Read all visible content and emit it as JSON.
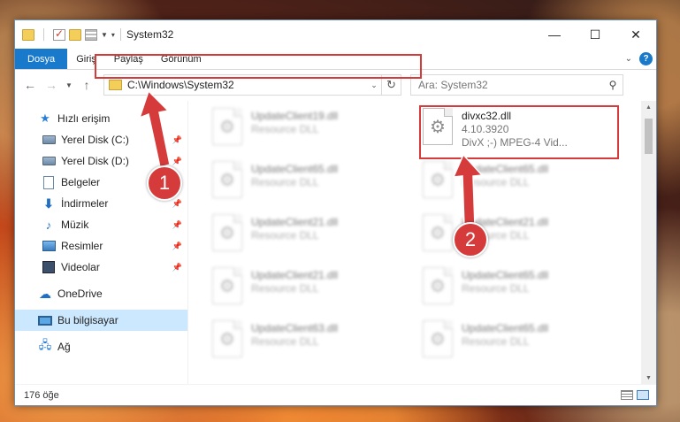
{
  "window": {
    "title": "System32",
    "controls": {
      "minimize": "—",
      "maximize": "☐",
      "close": "✕"
    }
  },
  "ribbon": {
    "tabs": [
      "Dosya",
      "Giriş",
      "Paylaş",
      "Görünüm"
    ],
    "help": "?"
  },
  "address": {
    "path": "C:\\Windows\\System32",
    "search_placeholder": "Ara: System32"
  },
  "sidebar": {
    "quick_access": "Hızlı erişim",
    "items": [
      {
        "label": "Yerel Disk (C:)",
        "icon": "drive-icon"
      },
      {
        "label": "Yerel Disk (D:)",
        "icon": "drive-icon"
      },
      {
        "label": "Belgeler",
        "icon": "documents-icon"
      },
      {
        "label": "İndirmeler",
        "icon": "downloads-icon"
      },
      {
        "label": "Müzik",
        "icon": "music-icon"
      },
      {
        "label": "Resimler",
        "icon": "pictures-icon"
      },
      {
        "label": "Videolar",
        "icon": "videos-icon"
      }
    ],
    "onedrive": "OneDrive",
    "this_pc": "Bu bilgisayar",
    "network": "Ağ"
  },
  "files": {
    "left_column": [
      {
        "name": "UpdateClient19.dll",
        "type": "Resource DLL"
      },
      {
        "name": "UpdateClient65.dll",
        "type": "Resource DLL"
      },
      {
        "name": "UpdateClient21.dll",
        "type": "Resource DLL"
      },
      {
        "name": "UpdateClient21.dll",
        "type": "Resource DLL"
      },
      {
        "name": "UpdateClient63.dll",
        "type": "Resource DLL"
      }
    ],
    "highlighted": {
      "name": "divxc32.dll",
      "version": "4.10.3920",
      "description": "DivX ;-) MPEG-4 Vid..."
    },
    "right_column": [
      {
        "name": "UpdateClient65.dll",
        "type": "Resource DLL"
      },
      {
        "name": "UpdateClient21.dll",
        "type": "Resource DLL"
      },
      {
        "name": "UpdateClient65.dll",
        "type": "Resource DLL"
      },
      {
        "name": "UpdateClient65.dll",
        "type": "Resource DLL"
      }
    ]
  },
  "status": {
    "item_count": "176 öğe"
  },
  "annotations": {
    "step1": "1",
    "step2": "2",
    "color": "#d53b3b"
  }
}
